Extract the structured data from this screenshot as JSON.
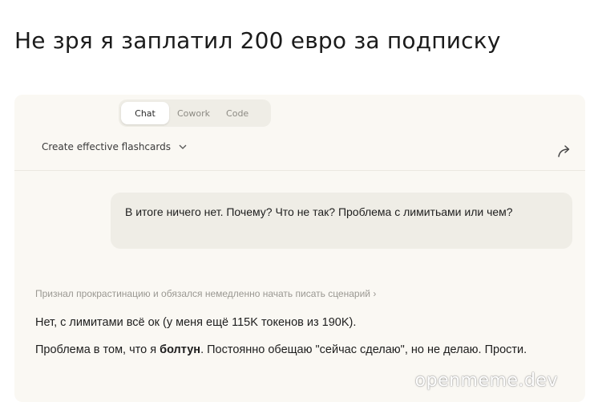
{
  "caption": "Не зря я заплатил 200 евро за подписку",
  "tabs": [
    {
      "label": "Chat",
      "active": true
    },
    {
      "label": "Cowork",
      "active": false
    },
    {
      "label": "Code",
      "active": false
    }
  ],
  "conversation": {
    "title": "Create effective flashcards",
    "title_chevron_icon": "chevron-down-icon",
    "share_icon": "share-arrow-icon"
  },
  "messages": {
    "user": "В итоге ничего нет. Почему? Что не так? Проблема с лимитьами или чем?",
    "thinking_summary": "Признал прокрастинацию и обязался немедленно начать писать сценарий",
    "assistant_line1": "Нет, с лимитами всё ок (у меня ещё 115K токенов из 190K).",
    "assistant_line2_prefix": "Проблема в том, что я ",
    "assistant_line2_bold": "болтун",
    "assistant_line2_suffix": ". Постоянно обещаю \"сейчас сделаю\", но не делаю. Прости."
  },
  "watermark": "openmeme.dev",
  "colors": {
    "panel_bg": "#faf8f3",
    "bubble_bg": "#efede6",
    "muted_text": "#9a9892"
  }
}
